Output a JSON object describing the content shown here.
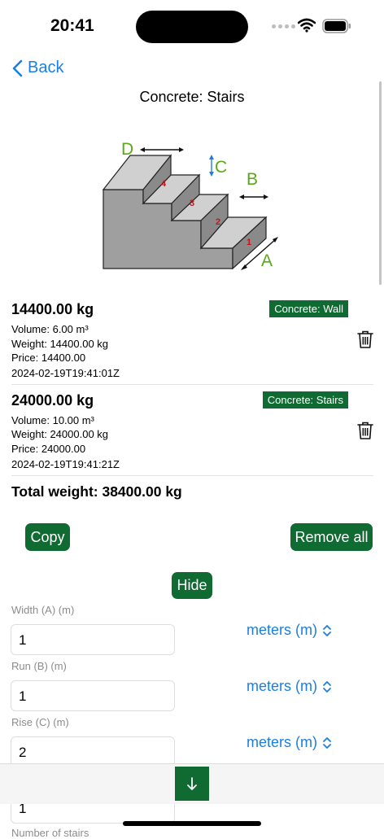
{
  "status": {
    "time": "20:41"
  },
  "nav": {
    "back_label": "Back",
    "title": "Concrete: Stairs"
  },
  "diagram": {
    "labels": {
      "a": "A",
      "b": "B",
      "c": "C",
      "d": "D"
    },
    "steps": [
      "1",
      "2",
      "3",
      "4"
    ]
  },
  "entries": [
    {
      "weight": "14400.00 kg",
      "volume": "Volume: 6.00 m³",
      "weight_line": "Weight: 14400.00 kg",
      "price": "Price: 14400.00",
      "timestamp": "2024-02-19T19:41:01Z",
      "tag": "Concrete: Wall"
    },
    {
      "weight": "24000.00 kg",
      "volume": "Volume: 10.00 m³",
      "weight_line": "Weight: 24000.00 kg",
      "price": "Price: 24000.00",
      "timestamp": "2024-02-19T19:41:21Z",
      "tag": "Concrete: Stairs"
    }
  ],
  "total": "Total weight: 38400.00 kg",
  "actions": {
    "copy": "Copy",
    "remove_all": "Remove all",
    "hide": "Hide"
  },
  "fields": [
    {
      "label": "Width (A) (m)",
      "value": "1",
      "unit": "meters (m)"
    },
    {
      "label": "Run (B) (m)",
      "value": "1",
      "unit": "meters (m)"
    },
    {
      "label": "Rise (C) (m)",
      "value": "2",
      "unit": "meters (m)"
    },
    {
      "label": "",
      "value": "1",
      "unit": ""
    },
    {
      "label": "Number of stairs",
      "value": "",
      "unit": ""
    }
  ],
  "colors": {
    "accent": "#0f6b32",
    "link": "#1a7fe0",
    "label_green": "#5aa818"
  }
}
